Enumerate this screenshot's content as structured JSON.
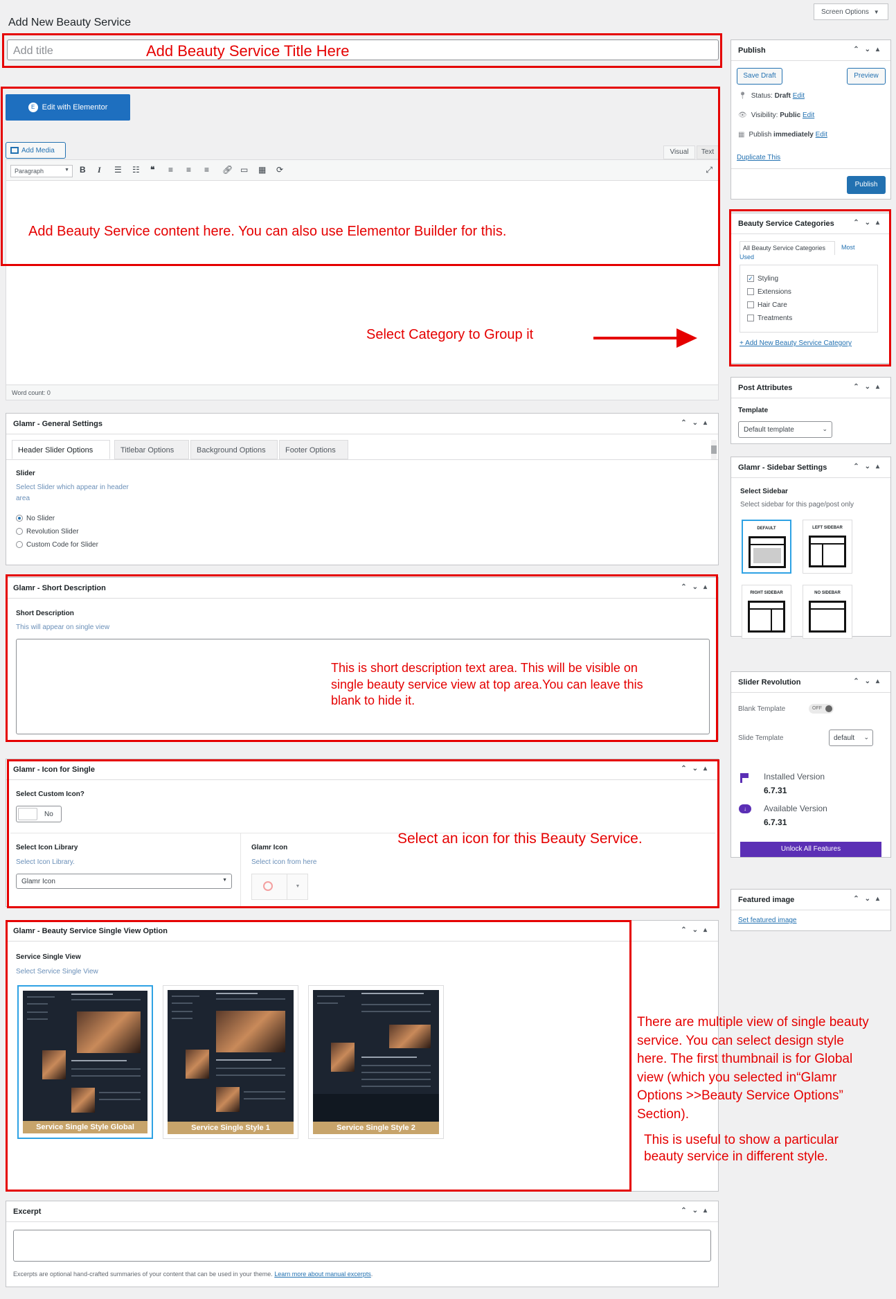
{
  "page": {
    "title": "Add New Beauty Service",
    "screen_options": "Screen Options"
  },
  "title_box": {
    "placeholder": "Add title"
  },
  "editor": {
    "elementor_button": "Edit with Elementor",
    "add_media": "Add Media",
    "tab_visual": "Visual",
    "tab_text": "Text",
    "format_select": "Paragraph",
    "word_count": "Word count: 0"
  },
  "publish": {
    "title": "Publish",
    "save_draft": "Save Draft",
    "preview": "Preview",
    "status_label": "Status:",
    "status_value": "Draft",
    "visibility_label": "Visibility:",
    "visibility_value": "Public",
    "publish_label": "Publish",
    "publish_value": "immediately",
    "edit": "Edit",
    "duplicate": "Duplicate This",
    "publish_button": "Publish"
  },
  "categories": {
    "title": "Beauty Service Categories",
    "tab_all": "All Beauty Service Categories",
    "tab_most_1": "Most",
    "tab_most_2": "Used",
    "items": [
      {
        "label": "Styling",
        "checked": true
      },
      {
        "label": "Extensions",
        "checked": false
      },
      {
        "label": "Hair Care",
        "checked": false
      },
      {
        "label": "Treatments",
        "checked": false
      }
    ],
    "add_new": "+ Add New Beauty Service Category"
  },
  "post_attributes": {
    "title": "Post Attributes",
    "template_label": "Template",
    "template_value": "Default template"
  },
  "sidebar_settings": {
    "title": "Glamr - Sidebar Settings",
    "label": "Select Sidebar",
    "desc": "Select sidebar for this page/post only",
    "options": [
      "DEFAULT",
      "LEFT SIDEBAR",
      "RIGHT SIDEBAR",
      "NO SIDEBAR"
    ]
  },
  "slider_revolution": {
    "title": "Slider Revolution",
    "blank_template": "Blank Template",
    "toggle": "OFF",
    "slide_template": "Slide Template",
    "slide_value": "default",
    "installed_label": "Installed Version",
    "installed_value": "6.7.31",
    "available_label": "Available Version",
    "available_value": "6.7.31",
    "unlock": "Unlock All Features"
  },
  "featured_image": {
    "title": "Featured image",
    "set_link": "Set featured image"
  },
  "general_settings": {
    "title": "Glamr - General Settings",
    "tabs": [
      "Header Slider Options",
      "Titlebar Options",
      "Background Options",
      "Footer Options"
    ],
    "slider_label": "Slider",
    "slider_desc_1": "Select Slider which appear in header",
    "slider_desc_2": "area",
    "options": [
      "No Slider",
      "Revolution Slider",
      "Custom Code for Slider"
    ]
  },
  "short_description": {
    "title": "Glamr - Short Description",
    "label": "Short Description",
    "desc": "This will appear on single view"
  },
  "icon_single": {
    "title": "Glamr - Icon for Single",
    "custom_label": "Select Custom Icon?",
    "toggle": "No",
    "library_label": "Select Icon Library",
    "library_desc": "Select Icon Library.",
    "library_value": "Glamr Icon",
    "glamr_label": "Glamr Icon",
    "glamr_desc": "Select icon from here"
  },
  "single_view": {
    "title": "Glamr - Beauty Service Single View Option",
    "label": "Service Single View",
    "desc": "Select Service Single View",
    "thumbs": [
      "Service Single Style Global",
      "Service Single Style 1",
      "Service Single Style 2"
    ]
  },
  "excerpt": {
    "title": "Excerpt",
    "note": "Excerpts are optional hand-crafted summaries of your content that can be used in your theme.",
    "learn_more": "Learn more about manual excerpts"
  },
  "annotations": {
    "title": "Add Beauty Service Title Here",
    "content": "Add Beauty Service content here. You can also use Elementor Builder for this.",
    "category": "Select Category to Group it",
    "short_1": "This is short description text area. This will be visible on",
    "short_2": "single beauty service view at top area.You can leave this",
    "short_3": "blank to hide it.",
    "icon": "Select an icon for this Beauty Service.",
    "view_1": "There are multiple view of single beauty",
    "view_2": "service. You can select design style",
    "view_3": "here. The first thumbnail is for Global",
    "view_4": "view (which you selected in“Glamr",
    "view_5": " Options >>Beauty Service Options”",
    "view_6": "Section).",
    "useful_1": "This is useful to show a particular",
    "useful_2": "beauty service in different style."
  },
  "colors": {
    "accent": "#2271b1",
    "annotation_red": "#e50000",
    "unlock_purple": "#5b2fb5",
    "thumb_gold": "#c7a46b"
  }
}
